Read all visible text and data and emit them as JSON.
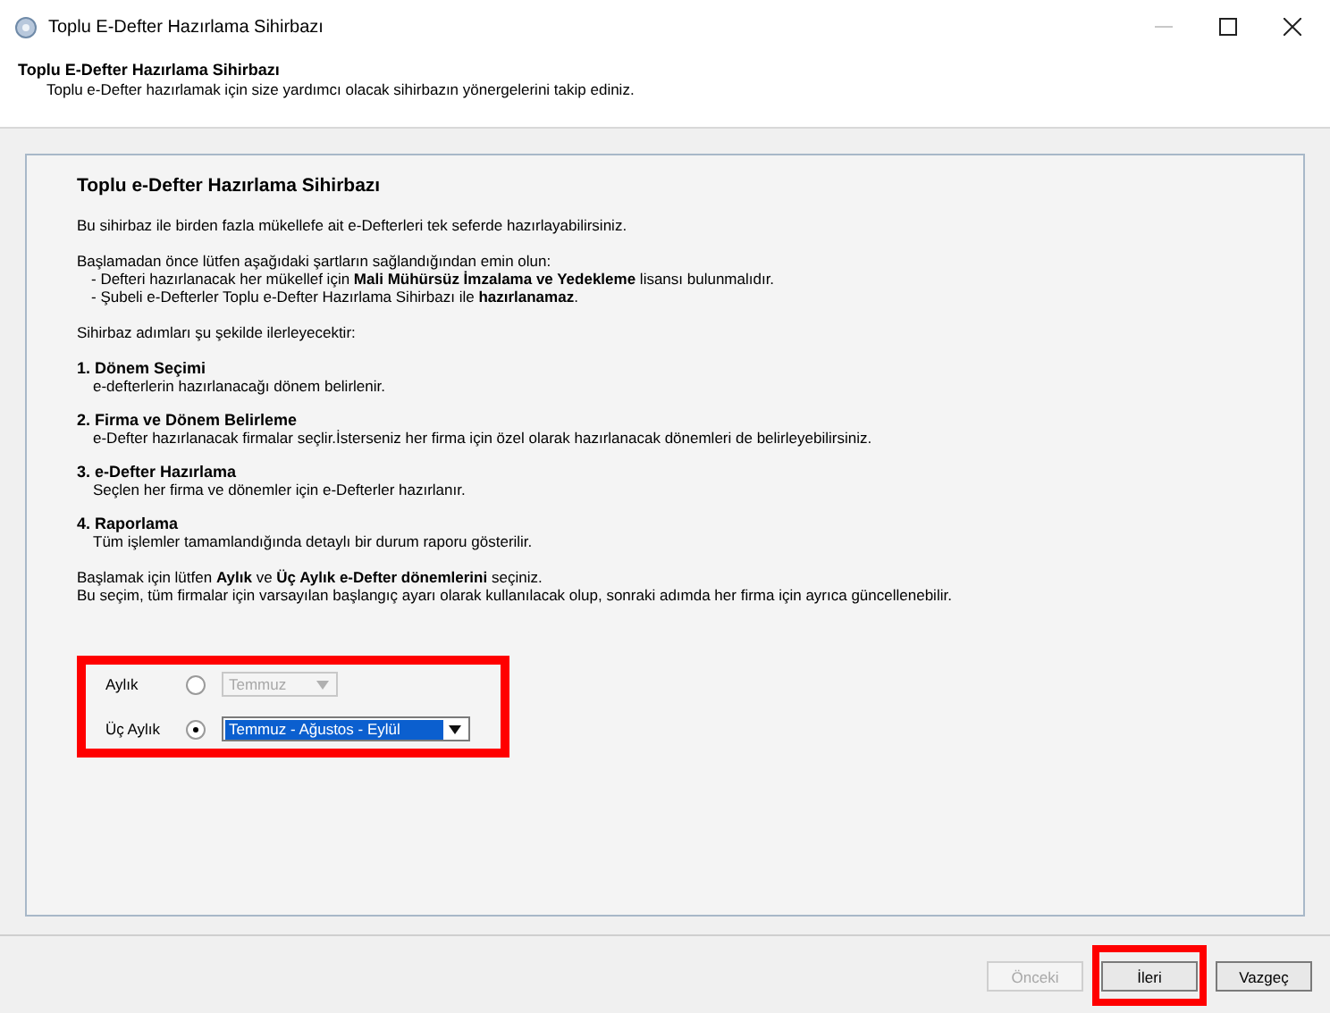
{
  "window": {
    "title": "Toplu E-Defter Hazırlama Sihirbazı"
  },
  "header": {
    "title": "Toplu E-Defter Hazırlama Sihirbazı",
    "subtitle": "Toplu e-Defter hazırlamak için size yardımcı olacak sihirbazın yönergelerini takip ediniz."
  },
  "panel": {
    "title": "Toplu e-Defter Hazırlama Sihirbazı",
    "intro": "Bu sihirbaz ile birden fazla mükellefe ait e-Defterleri tek seferde hazırlayabilirsiniz.",
    "requirements_heading": "Başlamadan önce lütfen aşağıdaki şartların sağlandığından emin olun:",
    "requirements": [
      "- Defteri hazırlanacak her mükellef için **Mali Mühürsüz İmzalama ve Yedekleme** lisansı bulunmalıdır.",
      "- Şubeli e-Defterler Toplu e-Defter Hazırlama Sihirbazı ile **hazırlanamaz**."
    ],
    "steps_heading": "Sihirbaz adımları şu şekilde ilerleyecektir:",
    "steps": [
      {
        "title": "1. Dönem Seçimi",
        "description": "e-defterlerin hazırlanacağı dönem belirlenir."
      },
      {
        "title": "2. Firma ve Dönem Belirleme",
        "description": "e-Defter hazırlanacak firmalar seçlir.İsterseniz her firma için özel olarak hazırlanacak dönemleri de belirleyebilirsiniz."
      },
      {
        "title": "3. e-Defter Hazırlama",
        "description": "Seçlen her firma ve dönemler için e-Defterler hazırlanır."
      },
      {
        "title": "4. Raporlama",
        "description": "Tüm işlemler tamamlandığında detaylı bir durum raporu gösterilir."
      }
    ],
    "closing": [
      "Başlamak için lütfen **Aylık** ve **Üç Aylık e-Defter dönemlerini** seçiniz.",
      "Bu seçim, tüm firmalar için varsayılan başlangıç ayarı olarak kullanılacak olup, sonraki adımda her firma için ayrıca güncellenebilir."
    ],
    "period_options_highlighted": true,
    "period_options": [
      {
        "label": "Aylık",
        "selected": false,
        "value": "Temmuz"
      },
      {
        "label": "Üç Aylık",
        "selected": true,
        "value": "Temmuz - Ağustos - Eylül"
      }
    ]
  },
  "buttons": [
    {
      "label": "Önceki",
      "disabled": true,
      "highlighted": false
    },
    {
      "label": "İleri",
      "disabled": false,
      "highlighted": true
    },
    {
      "label": "Vazgeç",
      "disabled": false,
      "highlighted": false
    }
  ]
}
